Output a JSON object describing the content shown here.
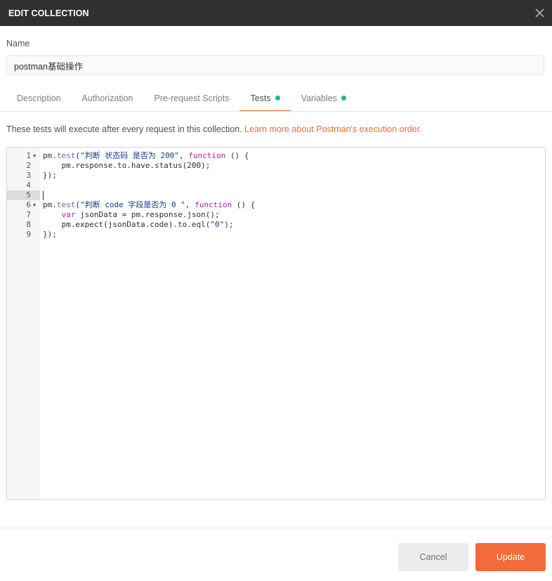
{
  "header": {
    "title": "EDIT COLLECTION",
    "close_icon": "close-icon"
  },
  "name": {
    "label": "Name",
    "value": "postman基础操作"
  },
  "tabs": [
    {
      "label": "Description",
      "active": false,
      "dot": false
    },
    {
      "label": "Authorization",
      "active": false,
      "dot": false
    },
    {
      "label": "Pre-request Scripts",
      "active": false,
      "dot": false
    },
    {
      "label": "Tests",
      "active": true,
      "dot": true
    },
    {
      "label": "Variables",
      "active": false,
      "dot": true
    }
  ],
  "tests": {
    "info_text": "These tests will execute after every request in this collection. ",
    "info_link": "Learn more about Postman's execution order."
  },
  "editor": {
    "active_line": 5,
    "lines": [
      {
        "n": "1",
        "fold": true
      },
      {
        "n": "2",
        "fold": false
      },
      {
        "n": "3",
        "fold": false
      },
      {
        "n": "4",
        "fold": false
      },
      {
        "n": "5",
        "fold": false
      },
      {
        "n": "6",
        "fold": true
      },
      {
        "n": "7",
        "fold": false
      },
      {
        "n": "8",
        "fold": false
      },
      {
        "n": "9",
        "fold": false
      }
    ],
    "code": {
      "l1_a": "pm.",
      "l1_fn": "test",
      "l1_b": "(",
      "l1_str": "\"判断 状态码 是否为 200\"",
      "l1_c": ", ",
      "l1_kw": "function",
      "l1_d": " () {",
      "l2": "    pm.response.to.have.status(200);",
      "l3": "});",
      "l4": "",
      "l5": "",
      "l6_a": "pm.",
      "l6_fn": "test",
      "l6_b": "(",
      "l6_str": "\"判断 code 字段是否为 0 \"",
      "l6_c": ", ",
      "l6_kw": "function",
      "l6_d": " () {",
      "l7_indent": "    ",
      "l7_kw": "var",
      "l7_rest": " jsonData = pm.response.json();",
      "l8_a": "    pm.expect(jsonData.code).to.eql(",
      "l8_str": "\"0\"",
      "l8_b": ");",
      "l9": "});"
    }
  },
  "footer": {
    "cancel_label": "Cancel",
    "update_label": "Update"
  },
  "colors": {
    "accent": "#f26b3a",
    "header_bg": "#303030",
    "status_dot": "#26b47f"
  }
}
